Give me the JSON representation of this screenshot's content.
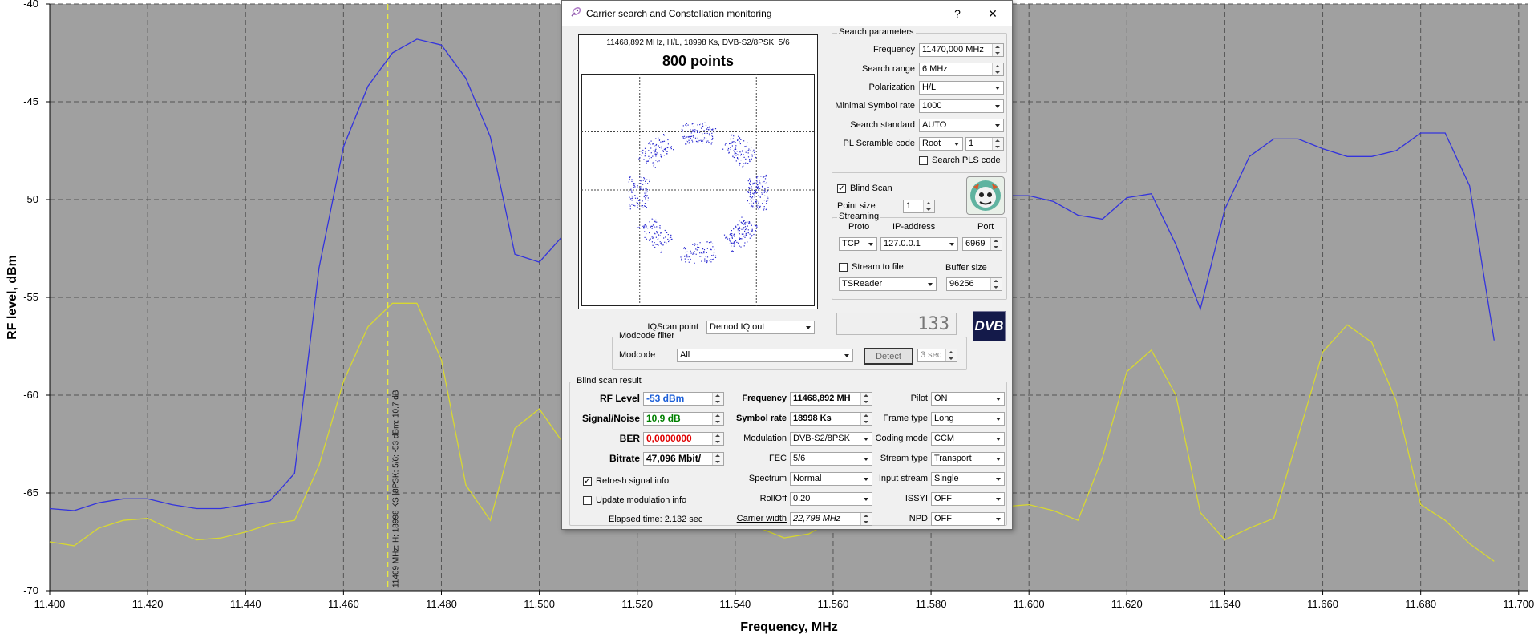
{
  "chart_data": {
    "type": "line",
    "xlabel": "Frequency, MHz",
    "ylabel": "RF level, dBm",
    "xlim": [
      11400,
      11702
    ],
    "ylim": [
      -70,
      -40
    ],
    "xticks": [
      "11.400",
      "11.420",
      "11.440",
      "11.460",
      "11.480",
      "11.500",
      "11.520",
      "11.540",
      "11.560",
      "11.580",
      "11.600",
      "11.620",
      "11.640",
      "11.660",
      "11.680",
      "11.700"
    ],
    "yticks": [
      "-40",
      "-45",
      "-50",
      "-55",
      "-60",
      "-65",
      "-70"
    ],
    "grid": true,
    "marker": {
      "x": 11469,
      "label": "11469 MHz; H; 18998 KS |8PSK; 5/6; -53 dBm; 10,7 dB"
    },
    "series": [
      {
        "color": "#3333dd",
        "x": [
          11400,
          11405,
          11410,
          11415,
          11420,
          11425,
          11430,
          11435,
          11440,
          11445,
          11450,
          11455,
          11460,
          11465,
          11470,
          11475,
          11480,
          11485,
          11490,
          11495,
          11500,
          11505,
          11510,
          11580,
          11585,
          11590,
          11595,
          11600,
          11605,
          11610,
          11615,
          11620,
          11625,
          11630,
          11635,
          11640,
          11645,
          11650,
          11655,
          11660,
          11665,
          11670,
          11675,
          11680,
          11685,
          11690,
          11695
        ],
        "values": [
          -65.8,
          -65.9,
          -65.5,
          -65.3,
          -65.3,
          -65.6,
          -65.8,
          -65.8,
          -65.6,
          -65.4,
          -64,
          -53.5,
          -47.3,
          -44.2,
          -42.5,
          -41.8,
          -42.1,
          -43.8,
          -46.8,
          -52.8,
          -53.2,
          -51.8,
          -48.8,
          -46.3,
          -47.3,
          -49.2,
          -49.8,
          -49.8,
          -50.1,
          -50.8,
          -51.0,
          -49.9,
          -49.7,
          -52.3,
          -55.6,
          -50.5,
          -47.8,
          -46.9,
          -46.9,
          -47.4,
          -47.8,
          -47.8,
          -47.5,
          -46.6,
          -46.6,
          -49.3,
          -57.2
        ]
      },
      {
        "color": "#d8d830",
        "x": [
          11400,
          11405,
          11410,
          11415,
          11420,
          11425,
          11430,
          11435,
          11440,
          11445,
          11450,
          11455,
          11460,
          11465,
          11470,
          11475,
          11480,
          11485,
          11490,
          11495,
          11500,
          11505,
          11510,
          11520,
          11540,
          11545,
          11550,
          11555,
          11560,
          11600,
          11605,
          11610,
          11615,
          11620,
          11625,
          11630,
          11635,
          11640,
          11645,
          11650,
          11655,
          11660,
          11665,
          11670,
          11675,
          11680,
          11685,
          11690,
          11695
        ],
        "values": [
          -67.5,
          -67.7,
          -66.8,
          -66.4,
          -66.3,
          -66.9,
          -67.4,
          -67.3,
          -67.0,
          -66.6,
          -66.4,
          -63.6,
          -59.3,
          -56.5,
          -55.3,
          -55.3,
          -58.2,
          -64.6,
          -66.4,
          -61.7,
          -60.7,
          -62.5,
          -64.5,
          -66.0,
          -66.5,
          -66.8,
          -67.3,
          -67.1,
          -66.4,
          -65.6,
          -65.9,
          -66.4,
          -63.2,
          -58.8,
          -57.7,
          -60.0,
          -66.0,
          -67.4,
          -66.8,
          -66.3,
          -62.1,
          -57.8,
          -56.4,
          -57.3,
          -60.3,
          -65.6,
          -66.4,
          -67.6,
          -68.5
        ]
      }
    ]
  },
  "dialog": {
    "title": "Carrier search and Constellation monitoring",
    "help": "?",
    "close": "✕",
    "constellation": {
      "info": "11468,892 MHz, H/L, 18998 Ks, DVB-S2/8PSK, 5/6",
      "points_label": "800 points"
    },
    "iq": {
      "label": "IQScan point",
      "value": "Demod IQ out"
    },
    "lcd": "133",
    "dvb_logo": "DVB",
    "search": {
      "title": "Search parameters",
      "frequency_label": "Frequency",
      "frequency": "11470,000 MHz",
      "range_label": "Search range",
      "range": "6 MHz",
      "polarization_label": "Polarization",
      "polarization": "H/L",
      "minsr_label": "Minimal Symbol rate",
      "minsr": "1000",
      "standard_label": "Search standard",
      "standard": "AUTO",
      "pls_label": "PL Scramble code",
      "pls_mode": "Root",
      "pls_value": "1",
      "search_pls_label": "Search PLS code"
    },
    "blind_scan_label": "Blind Scan",
    "point_size_label": "Point size",
    "point_size": "1",
    "streaming": {
      "title": "Streaming",
      "proto_header": "Proto",
      "ip_header": "IP-address",
      "port_header": "Port",
      "proto": "TCP",
      "ip": "127.0.0.1",
      "port": "6969",
      "stream_to_file_label": "Stream to file",
      "buffer_header": "Buffer size",
      "target": "TSReader",
      "buffer": "96256"
    },
    "modcode": {
      "title": "Modcode filter",
      "label": "Modcode",
      "value": "All",
      "detect": "Detect",
      "timeout": "3 sec"
    },
    "result": {
      "title": "Blind scan result",
      "rf_label": "RF Level",
      "rf": "-53 dBm",
      "snr_label": "Signal/Noise",
      "snr": "10,9 dB",
      "ber_label": "BER",
      "ber": "0,0000000",
      "bitrate_label": "Bitrate",
      "bitrate": "47,096 Mbit/",
      "freq_label": "Frequency",
      "freq": "11468,892 MH",
      "sr_label": "Symbol rate",
      "sr": "18998 Ks",
      "mod_label": "Modulation",
      "mod": "DVB-S2/8PSK",
      "fec_label": "FEC",
      "fec": "5/6",
      "spectrum_label": "Spectrum",
      "spectrum": "Normal",
      "rolloff_label": "RollOff",
      "rolloff": "0.20",
      "cw_label": "Carrier width",
      "cw": "22,798 MHz",
      "pilot_label": "Pilot",
      "pilot": "ON",
      "frame_label": "Frame type",
      "frame": "Long",
      "coding_label": "Coding mode",
      "coding": "CCM",
      "stype_label": "Stream type",
      "stype": "Transport",
      "input_label": "Input stream",
      "input": "Single",
      "issyi_label": "ISSYI",
      "issyi": "OFF",
      "npd_label": "NPD",
      "npd": "OFF",
      "refresh_label": "Refresh signal info",
      "update_label": "Update modulation info",
      "elapsed": "Elapsed time: 2.132 sec"
    },
    "colors": {
      "rf": "#1c5fd8",
      "snr": "#008000",
      "ber": "#e00000"
    }
  }
}
